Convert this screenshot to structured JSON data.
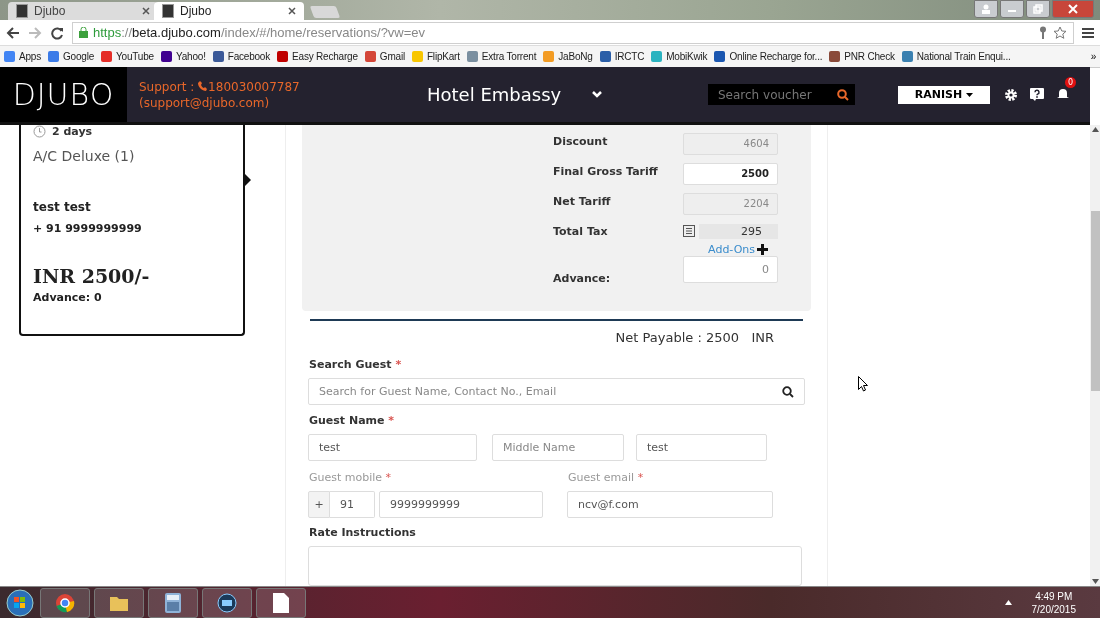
{
  "browser": {
    "tabs": [
      {
        "title": "Djubo",
        "selected": false
      },
      {
        "title": "Djubo",
        "selected": true
      }
    ],
    "address": {
      "scheme": "https",
      "separator": "://",
      "host": "beta.djubo.com",
      "path": "/index/#/home/reservations/?vw=ev"
    },
    "bookmarks": [
      {
        "label": "Apps",
        "color": "#4285f4"
      },
      {
        "label": "Google",
        "color": "#3b7be8"
      },
      {
        "label": "YouTube",
        "color": "#e52d27"
      },
      {
        "label": "Yahoo!",
        "color": "#400090"
      },
      {
        "label": "Facebook",
        "color": "#3b5998"
      },
      {
        "label": "Easy Recharge",
        "color": "#c00000"
      },
      {
        "label": "Gmail",
        "color": "#d44638"
      },
      {
        "label": "FlipKart",
        "color": "#f8c600"
      },
      {
        "label": "Extra Torrent",
        "color": "#7a8fa0"
      },
      {
        "label": "JaBoNg",
        "color": "#f39c24"
      },
      {
        "label": "IRCTC",
        "color": "#2a5ea8"
      },
      {
        "label": "MobiKwik",
        "color": "#2bb3c0"
      },
      {
        "label": "Online Recharge for...",
        "color": "#1a56b0"
      },
      {
        "label": "PNR Check",
        "color": "#8a4a3a"
      },
      {
        "label": "National Train Enqui...",
        "color": "#3a80b0"
      }
    ],
    "more": "»"
  },
  "header": {
    "logo": "DJUBO",
    "support_label": "Support : ",
    "support_phone": "180030007787",
    "support_email": "(support@djubo.com)",
    "hotel": "Hotel Embassy",
    "search_placeholder": "Search voucher",
    "user": "RANISH",
    "notifications": "0"
  },
  "booking_card": {
    "duration": "2 days",
    "room": "A/C Deluxe (1)",
    "guest_name": "test test",
    "phone": "+ 91 9999999999",
    "amount": "INR 2500/-",
    "advance": "Advance: 0"
  },
  "tariff": {
    "rows": [
      {
        "kind": "readonly",
        "label": "Discount",
        "value": "4604"
      },
      {
        "kind": "editable",
        "label": "Final Gross Tariff",
        "value": "2500"
      },
      {
        "kind": "readonly",
        "label": "Net Tariff",
        "value": "2204"
      },
      {
        "kind": "tax",
        "label": "Total Tax",
        "value": "295"
      }
    ],
    "addons": "Add-Ons",
    "advance_label": "Advance:",
    "advance_value": "0",
    "net_payable": "Net Payable : 2500   INR"
  },
  "guest_form": {
    "search_label": "Search Guest",
    "search_placeholder": "Search for Guest Name, Contact No., Email",
    "required_mark": "*",
    "name_label": "Guest Name",
    "first_name": "test",
    "middle_name_placeholder": "Middle Name",
    "last_name": "test",
    "mobile_label": "Guest mobile",
    "mobile_prefix": "+",
    "country_code": "91",
    "mobile": "9999999999",
    "email_label": "Guest email",
    "email": "ncv@f.com",
    "rate_label": "Rate Instructions"
  },
  "taskbar": {
    "time": "4:49 PM",
    "date": "7/20/2015"
  }
}
